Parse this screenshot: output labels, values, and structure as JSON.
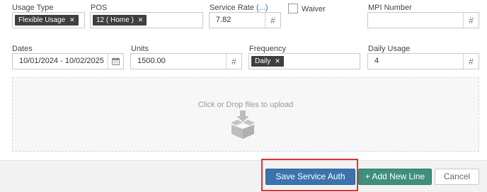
{
  "form": {
    "usage_type": {
      "label": "Usage Type",
      "tag": "Flexible Usage",
      "remove_icon": "close-icon"
    },
    "pos": {
      "label": "POS",
      "tag": "12 ( Home )",
      "remove_icon": "close-icon"
    },
    "service_rate": {
      "label": "Service Rate",
      "link": "(...)",
      "value": "7.82",
      "addon": "#"
    },
    "waiver": {
      "label": "Waiver",
      "checked": false
    },
    "mpi_number": {
      "label": "MPI Number",
      "value": "",
      "addon": "#"
    },
    "dates": {
      "label": "Dates",
      "value": "10/01/2024 - 10/02/2025",
      "addon_icon": "calendar-icon"
    },
    "units": {
      "label": "Units",
      "value": "1500.00",
      "addon": "#"
    },
    "frequency": {
      "label": "Frequency",
      "tag": "Daily",
      "remove_icon": "close-icon"
    },
    "daily_usage": {
      "label": "Daily Usage",
      "value": "4",
      "addon": "#"
    }
  },
  "dropzone": {
    "text": "Click or Drop files to upload",
    "icon": "upload-box-icon"
  },
  "footer": {
    "save_label": "Save Service Auth",
    "add_line_label": "+ Add New Line",
    "cancel_label": "Cancel"
  },
  "colors": {
    "primary": "#3a74ac",
    "success": "#3f8f7c",
    "tag_bg": "#3f3f3f",
    "highlight": "#e0313a"
  }
}
